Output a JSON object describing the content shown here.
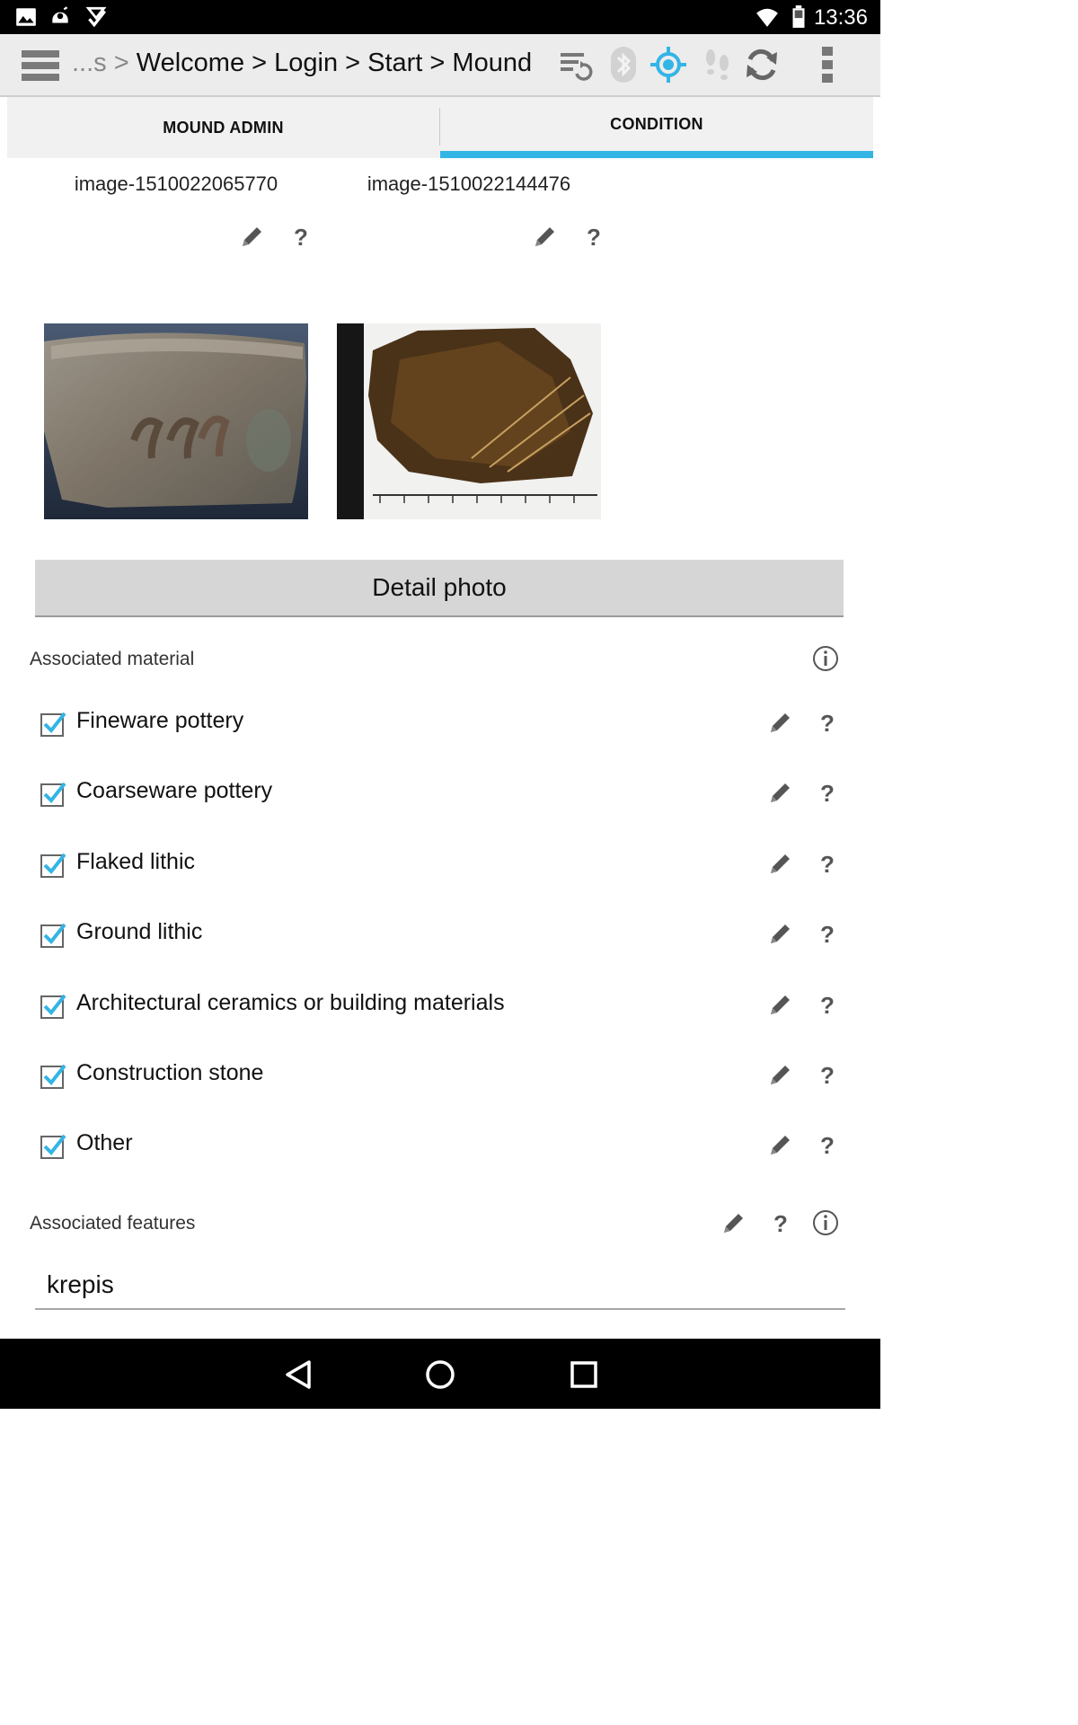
{
  "status_bar": {
    "time": "13:36",
    "left_icons": [
      "gallery-icon",
      "android-robot-icon",
      "download-done-icon"
    ],
    "right_icons": [
      "wifi-icon",
      "battery-icon"
    ]
  },
  "action_bar": {
    "breadcrumb_ellipsis": "...s >",
    "breadcrumb": "Welcome > Login > Start > Mound",
    "icons": [
      "menu-icon",
      "sync-list-icon",
      "bluetooth-icon",
      "gps-icon",
      "footsteps-icon",
      "refresh-icon",
      "overflow-menu-icon"
    ],
    "accent_color": "#33b5e5"
  },
  "tabs": [
    {
      "label": "MOUND ADMIN",
      "selected": false
    },
    {
      "label": "CONDITION",
      "selected": true
    }
  ],
  "photos": [
    {
      "name": "image-1510022065770"
    },
    {
      "name": "image-1510022144476"
    }
  ],
  "detail_photo_button": "Detail photo",
  "associated_material": {
    "label": "Associated material",
    "items": [
      {
        "label": "Fineware pottery",
        "checked": true
      },
      {
        "label": "Coarseware pottery",
        "checked": true
      },
      {
        "label": "Flaked lithic",
        "checked": true
      },
      {
        "label": "Ground lithic",
        "checked": true
      },
      {
        "label": "Architectural ceramics or building materials",
        "checked": true
      },
      {
        "label": "Construction stone",
        "checked": true
      },
      {
        "label": "Other",
        "checked": true
      }
    ]
  },
  "associated_features": {
    "label": "Associated features",
    "value": "krepis"
  }
}
